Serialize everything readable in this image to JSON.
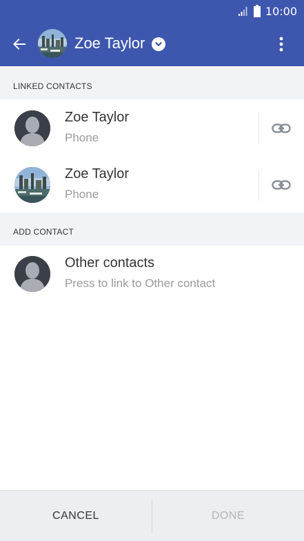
{
  "status_bar": {
    "time": "10:00"
  },
  "header": {
    "contact_name": "Zoe Taylor"
  },
  "sections": {
    "linked_title": "LINKED CONTACTS",
    "add_title": "ADD CONTACT"
  },
  "linked_contacts": [
    {
      "name": "Zoe Taylor",
      "source": "Phone"
    },
    {
      "name": "Zoe Taylor",
      "source": "Phone"
    }
  ],
  "add_contact": {
    "title": "Other contacts",
    "subtitle": "Press to link to Other contact"
  },
  "footer": {
    "cancel_label": "CANCEL",
    "done_label": "DONE"
  },
  "colors": {
    "primary": "#3e57ae",
    "section_bg": "#f2f3f7",
    "disabled_text": "#b3b3b3"
  }
}
